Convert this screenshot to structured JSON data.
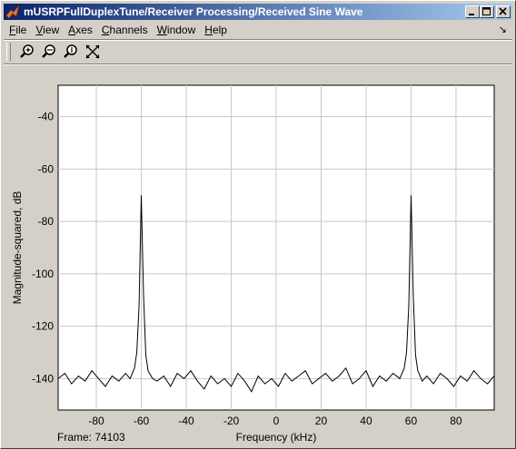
{
  "window": {
    "title": "mUSRPFullDuplexTune/Receiver Processing/Received Sine Wave"
  },
  "menu": {
    "file": {
      "u": "F",
      "rest": "ile"
    },
    "view": {
      "u": "V",
      "rest": "iew"
    },
    "axes": {
      "u": "A",
      "rest": "xes"
    },
    "channels": {
      "u": "C",
      "rest": "hannels"
    },
    "window": {
      "u": "W",
      "rest": "indow"
    },
    "help": {
      "u": "H",
      "rest": "elp"
    }
  },
  "toolbar": {
    "icons": [
      "zoom-in-icon",
      "zoom-x-icon",
      "zoom-y-icon",
      "autoscale-icon"
    ]
  },
  "status": {
    "frame": "Frame: 74103"
  },
  "colors": {
    "titlebar_start": "#0a246a",
    "titlebar_end": "#a6caf0",
    "plot_bg": "#ffffff",
    "grid": "#c8c8c8",
    "trace": "#000000"
  },
  "chart_data": {
    "type": "line",
    "xlabel": "Frequency (kHz)",
    "ylabel": "Magnitude-squared, dB",
    "xlim": [
      -97,
      97
    ],
    "ylim": [
      -152,
      -28
    ],
    "xticks": [
      -80,
      -60,
      -40,
      -20,
      0,
      20,
      40,
      60,
      80
    ],
    "yticks": [
      -40,
      -60,
      -80,
      -100,
      -120,
      -140
    ],
    "grid": true,
    "series": [
      {
        "x": [
          -97,
          -94,
          -91,
          -88,
          -85,
          -82,
          -79,
          -76,
          -73,
          -70,
          -67,
          -65,
          -63,
          -62,
          -61,
          -60,
          -59,
          -58,
          -57,
          -55,
          -53,
          -50,
          -47,
          -44,
          -41,
          -38,
          -35,
          -32,
          -29,
          -26,
          -23,
          -20,
          -17,
          -14,
          -11,
          -8,
          -5,
          -2,
          1,
          4,
          7,
          10,
          13,
          16,
          19,
          22,
          25,
          28,
          31,
          34,
          37,
          40,
          43,
          46,
          49,
          52,
          55,
          57,
          58,
          59,
          60,
          61,
          62,
          63,
          65,
          67,
          70,
          73,
          76,
          79,
          82,
          85,
          88,
          91,
          94,
          97
        ],
        "y": [
          -140,
          -138,
          -142,
          -139,
          -141,
          -137,
          -140,
          -143,
          -139,
          -141,
          -138,
          -140,
          -136,
          -130,
          -112,
          -70,
          -108,
          -131,
          -137,
          -140,
          -141,
          -139,
          -143,
          -138,
          -140,
          -137,
          -141,
          -144,
          -139,
          -142,
          -140,
          -143,
          -138,
          -141,
          -145,
          -139,
          -142,
          -140,
          -143,
          -138,
          -141,
          -139,
          -137,
          -142,
          -140,
          -138,
          -141,
          -139,
          -136,
          -142,
          -140,
          -137,
          -143,
          -139,
          -141,
          -138,
          -140,
          -136,
          -130,
          -112,
          -70,
          -108,
          -131,
          -137,
          -141,
          -139,
          -142,
          -138,
          -140,
          -143,
          -139,
          -141,
          -137,
          -140,
          -142,
          -139
        ]
      }
    ]
  }
}
